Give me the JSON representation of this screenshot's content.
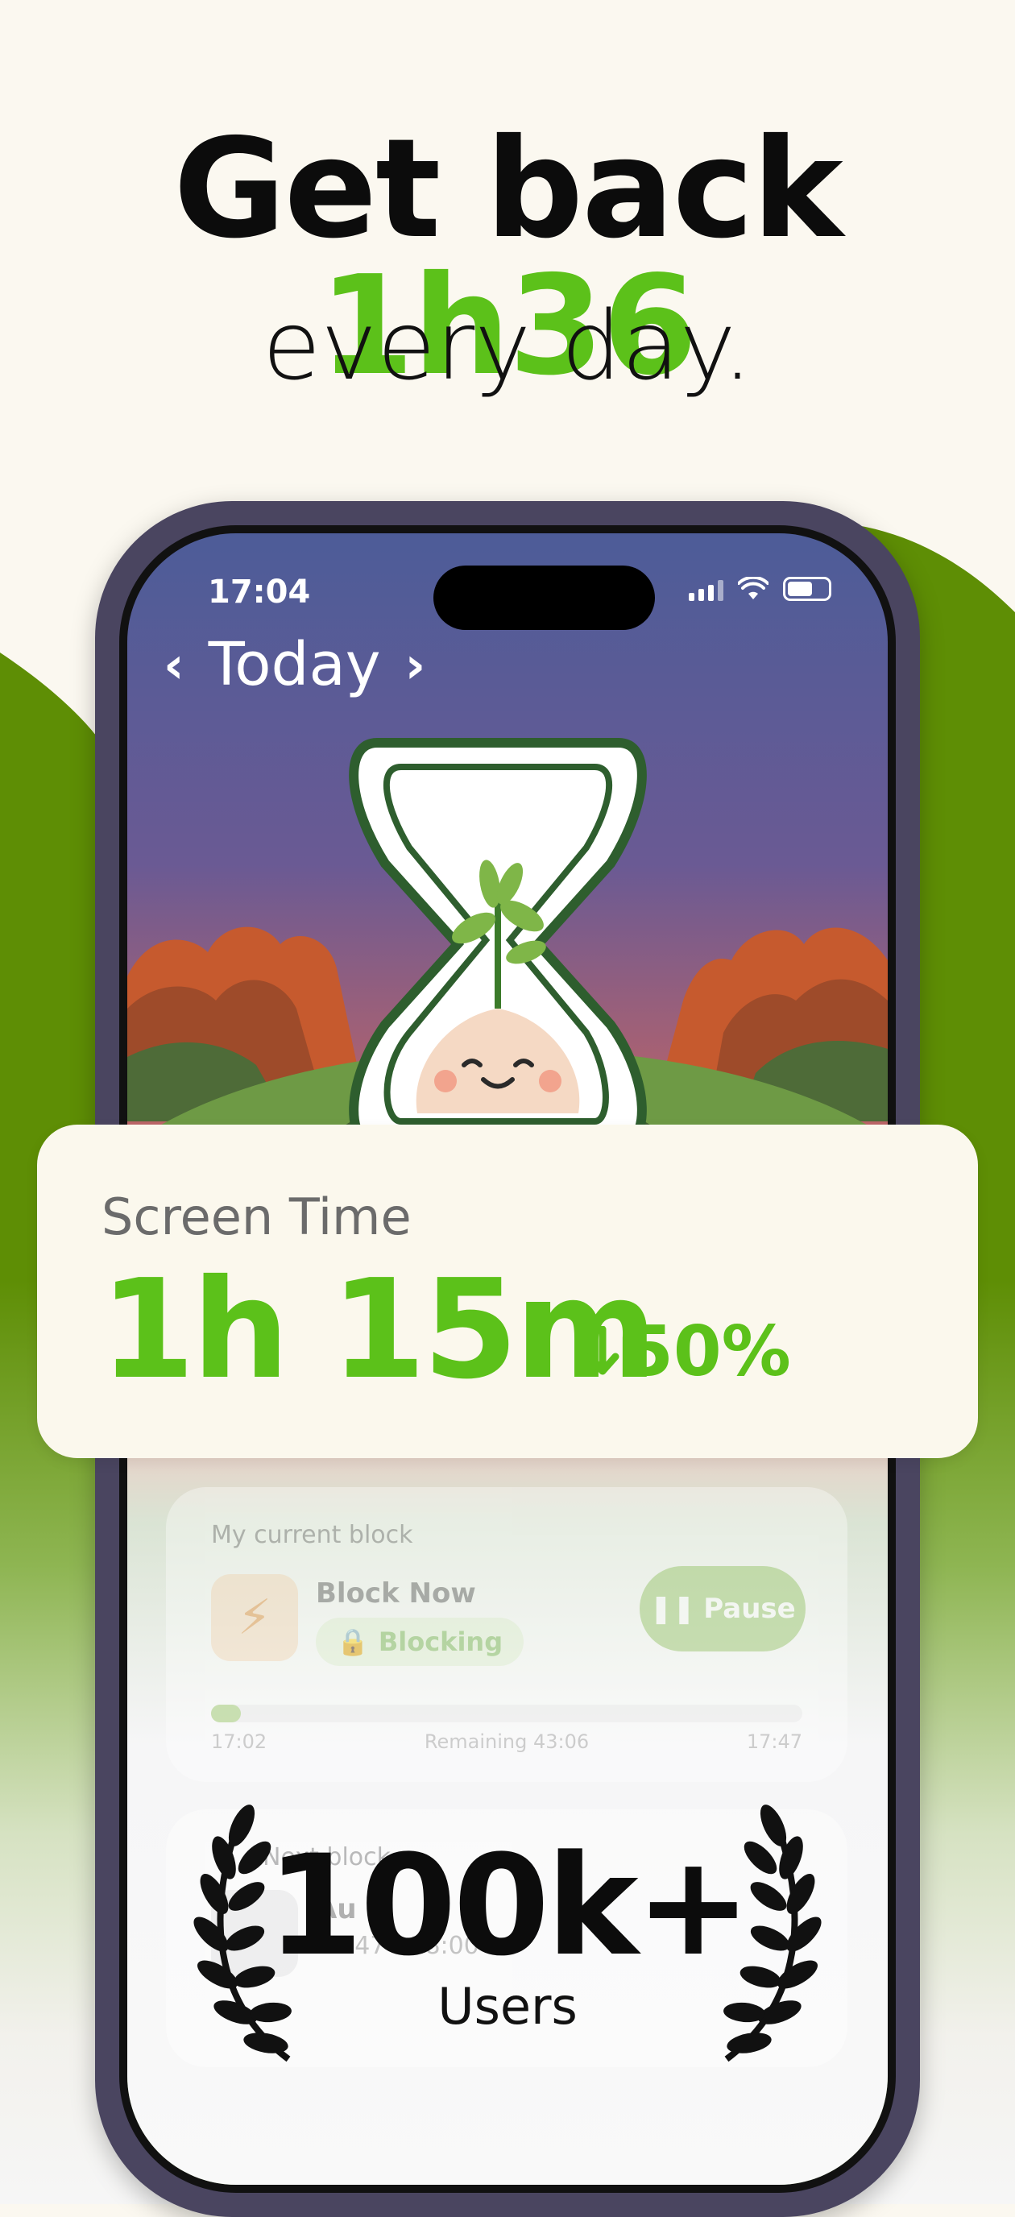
{
  "headline": {
    "prefix": "Get back ",
    "highlight": "1h36",
    "subtitle": "every day."
  },
  "phone": {
    "status_time": "17:04",
    "nav_title": "Today",
    "illustration_icon": "hourglass-sprout-icon"
  },
  "screen_time": {
    "label": "Screen Time",
    "value": "1h 15m",
    "delta": "50%",
    "delta_icon": "arrow-down-icon"
  },
  "current_block": {
    "title": "My current block",
    "name": "Block Now",
    "badge": "Blocking",
    "pause_label": "Pause",
    "start": "17:02",
    "remaining": "Remaining 43:06",
    "end": "17:47",
    "progress": 0.05
  },
  "next_block": {
    "title": "Next block",
    "name": "Au",
    "time": "17:47 - 18:00"
  },
  "users": {
    "count": "100k+",
    "label": "Users"
  },
  "colors": {
    "accent": "#5CC11A",
    "dark_green": "#5E8E05",
    "background": "#FBF8F0"
  }
}
